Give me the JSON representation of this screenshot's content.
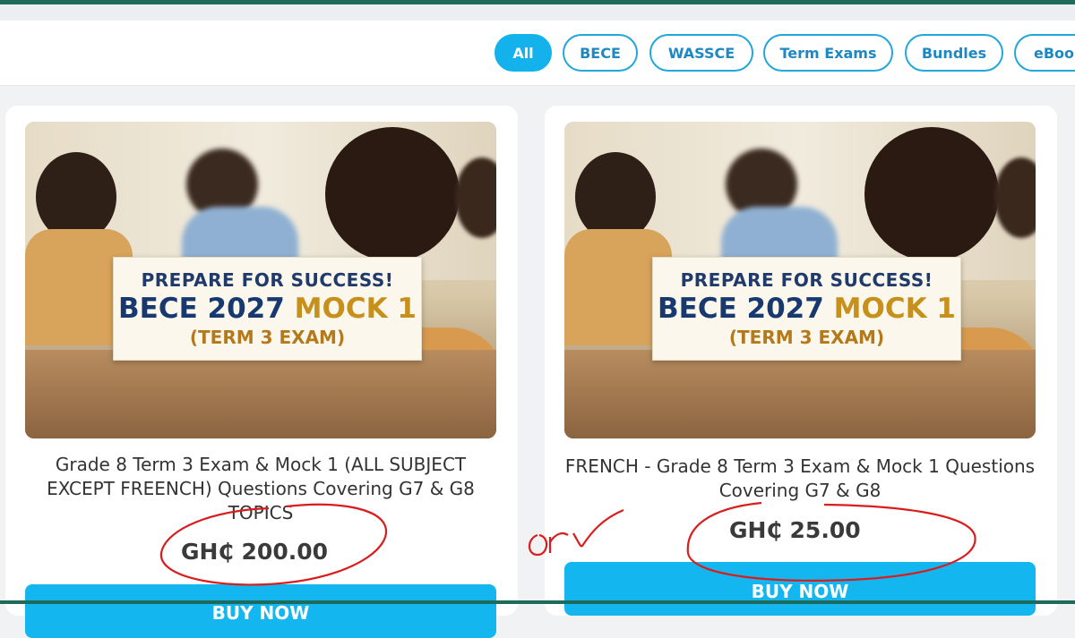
{
  "filters": {
    "chips": [
      {
        "label": "All",
        "active": true
      },
      {
        "label": "BECE",
        "active": false
      },
      {
        "label": "WASSCE",
        "active": false
      },
      {
        "label": "Term Exams",
        "active": false
      },
      {
        "label": "Bundles",
        "active": false
      },
      {
        "label": "eBooks",
        "active": false
      }
    ]
  },
  "products": [
    {
      "banner_line1": "PREPARE FOR SUCCESS!",
      "banner_bece": "BECE 2027",
      "banner_mock": "MOCK 1",
      "banner_line3": "(TERM 3 EXAM)",
      "title": "Grade 8 Term 3 Exam & Mock 1 (ALL SUBJECT EXCEPT FREENCH) Questions Covering G7 & G8 TOPICS",
      "price": "GH₵ 200.00",
      "buy_label": "BUY NOW"
    },
    {
      "banner_line1": "PREPARE FOR SUCCESS!",
      "banner_bece": "BECE 2027",
      "banner_mock": "MOCK 1",
      "banner_line3": "(TERM 3 EXAM)",
      "title": "FRENCH - Grade 8 Term 3 Exam & Mock 1 Questions Covering G7 & G8",
      "price": "GH₵ 25.00",
      "buy_label": "BUY NOW"
    }
  ],
  "annotation": {
    "text": "or",
    "color": "#d91c1c"
  }
}
